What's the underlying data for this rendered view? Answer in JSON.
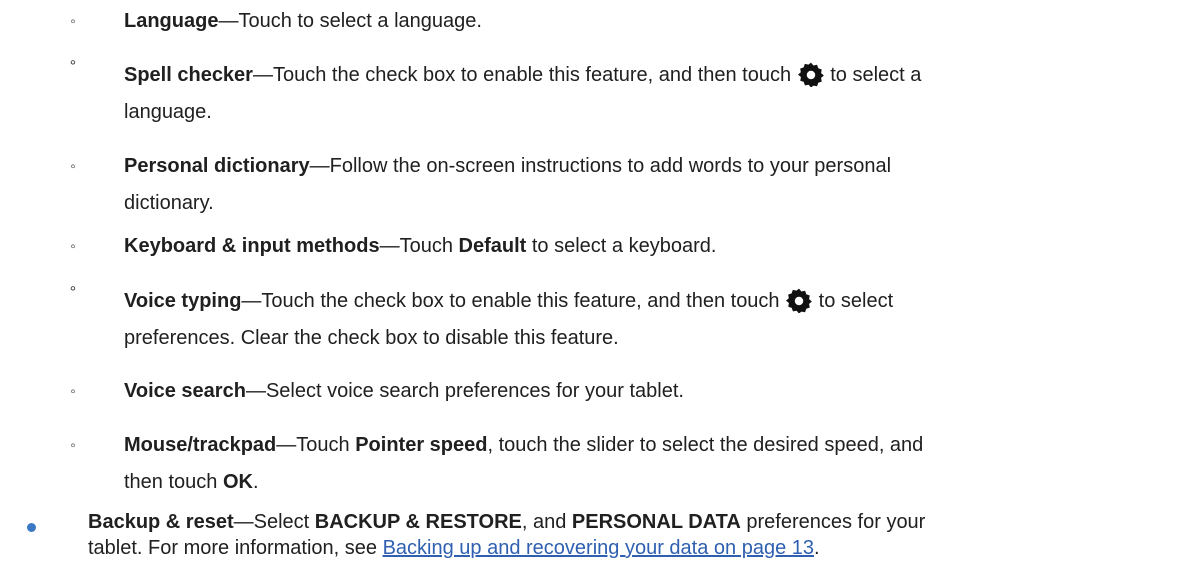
{
  "items": [
    {
      "term": "Language",
      "text1": "—Touch to select a language."
    },
    {
      "term": "Spell checker",
      "text1": "—Touch the check box to enable this feature, and then touch ",
      "text2": " to select a",
      "line2": "language."
    },
    {
      "term": "Personal dictionary",
      "text1": "—Follow the on-screen instructions to add words to your personal",
      "line2": "dictionary."
    },
    {
      "term": "Keyboard & input methods",
      "text1": "—Touch ",
      "bold1": "Default",
      "text2": " to select a keyboard."
    },
    {
      "term": "Voice typing",
      "text1": "—Touch the check box to enable this feature, and then touch ",
      "text2": " to select",
      "line2": "preferences. Clear the check box to disable this feature."
    },
    {
      "term": "Voice search",
      "text1": "—Select voice search preferences for your tablet."
    },
    {
      "term": "Mouse/trackpad",
      "text1": "—Touch ",
      "bold1": "Pointer speed",
      "text2": ", touch the slider to select the desired speed, and",
      "line2a": "then touch ",
      "line2b": "OK",
      "line2c": "."
    }
  ],
  "backup": {
    "term": "Backup & reset",
    "text1": "—Select ",
    "bold1": "BACKUP & RESTORE",
    "text2": ", and ",
    "bold2": "PERSONAL DATA",
    "text3": " preferences for your",
    "line2": "tablet. For more information, see ",
    "link": "Backing up and recovering your data on page 13",
    "end": "."
  },
  "icons": {
    "gear": "gear-icon"
  }
}
